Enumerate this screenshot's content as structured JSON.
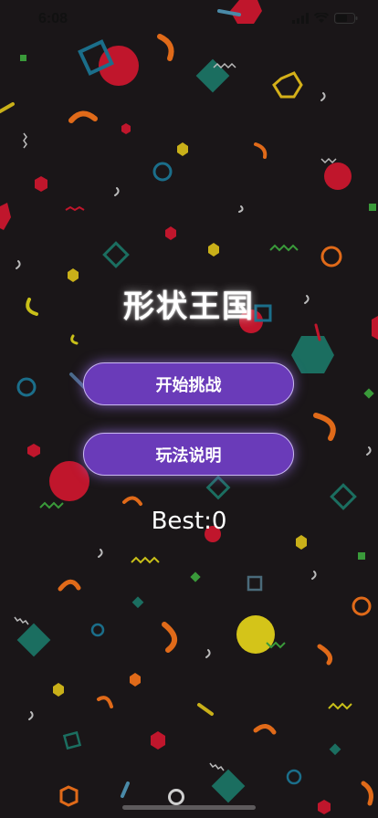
{
  "status_bar": {
    "time": "6:08"
  },
  "title": "形状王国",
  "buttons": {
    "start": "开始挑战",
    "help": "玩法说明"
  },
  "best": "Best:0",
  "colors": {
    "background": "#1a1618",
    "button": "#6a3bb9",
    "button_border": "#c9b7f0"
  }
}
